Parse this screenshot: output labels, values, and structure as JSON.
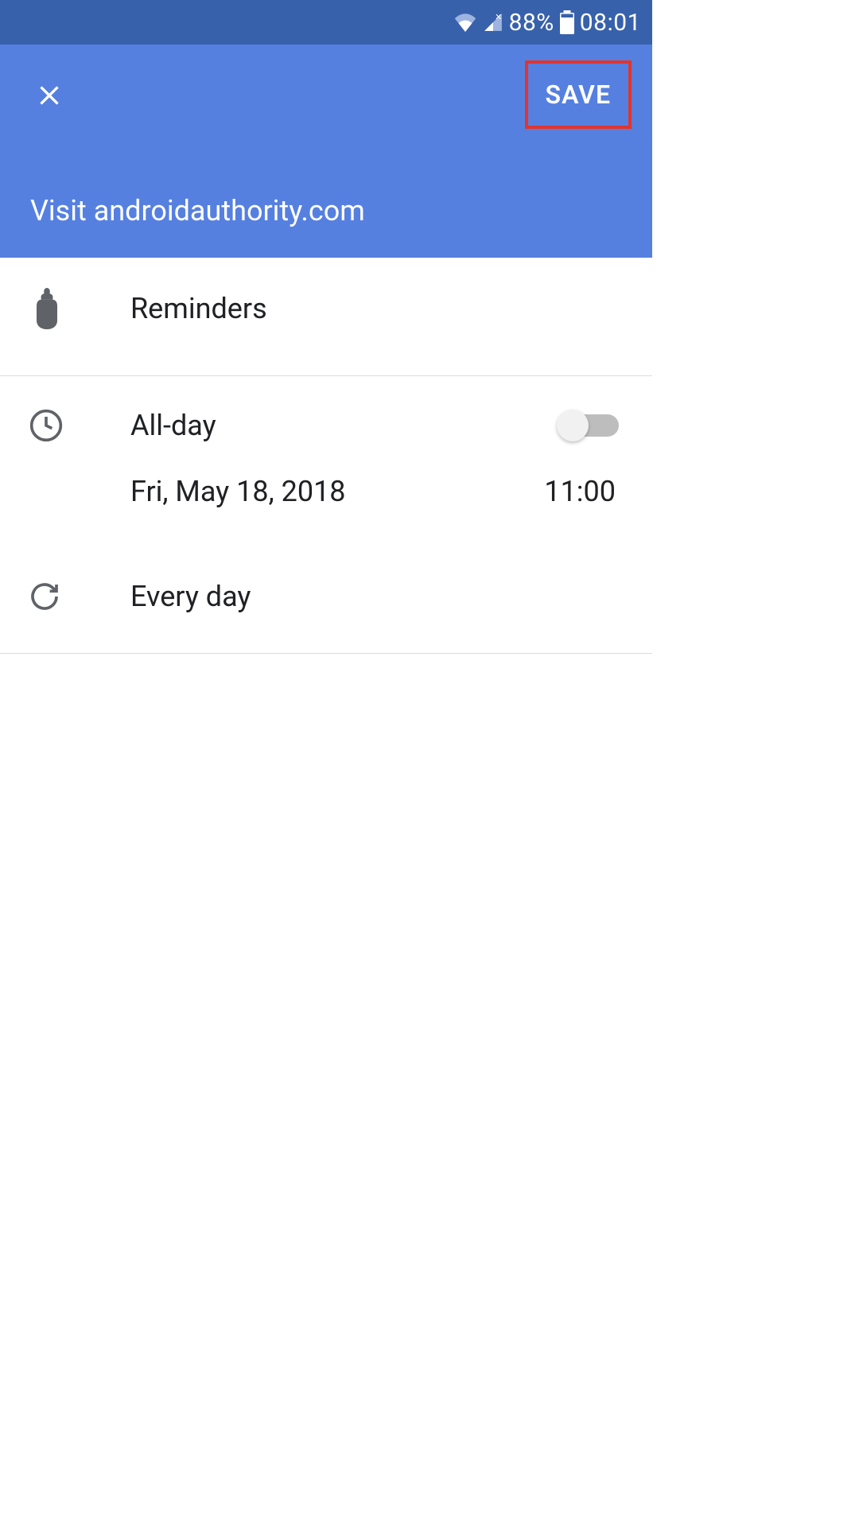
{
  "statusbar": {
    "battery_percent": "88%",
    "time": "08:01"
  },
  "header": {
    "save_label": "SAVE",
    "title": "Visit androidauthority.com"
  },
  "sections": {
    "reminders_label": "Reminders",
    "allday_label": "All-day",
    "allday_enabled": false,
    "date": "Fri, May 18, 2018",
    "time": "11:00",
    "repeat_label": "Every day"
  }
}
